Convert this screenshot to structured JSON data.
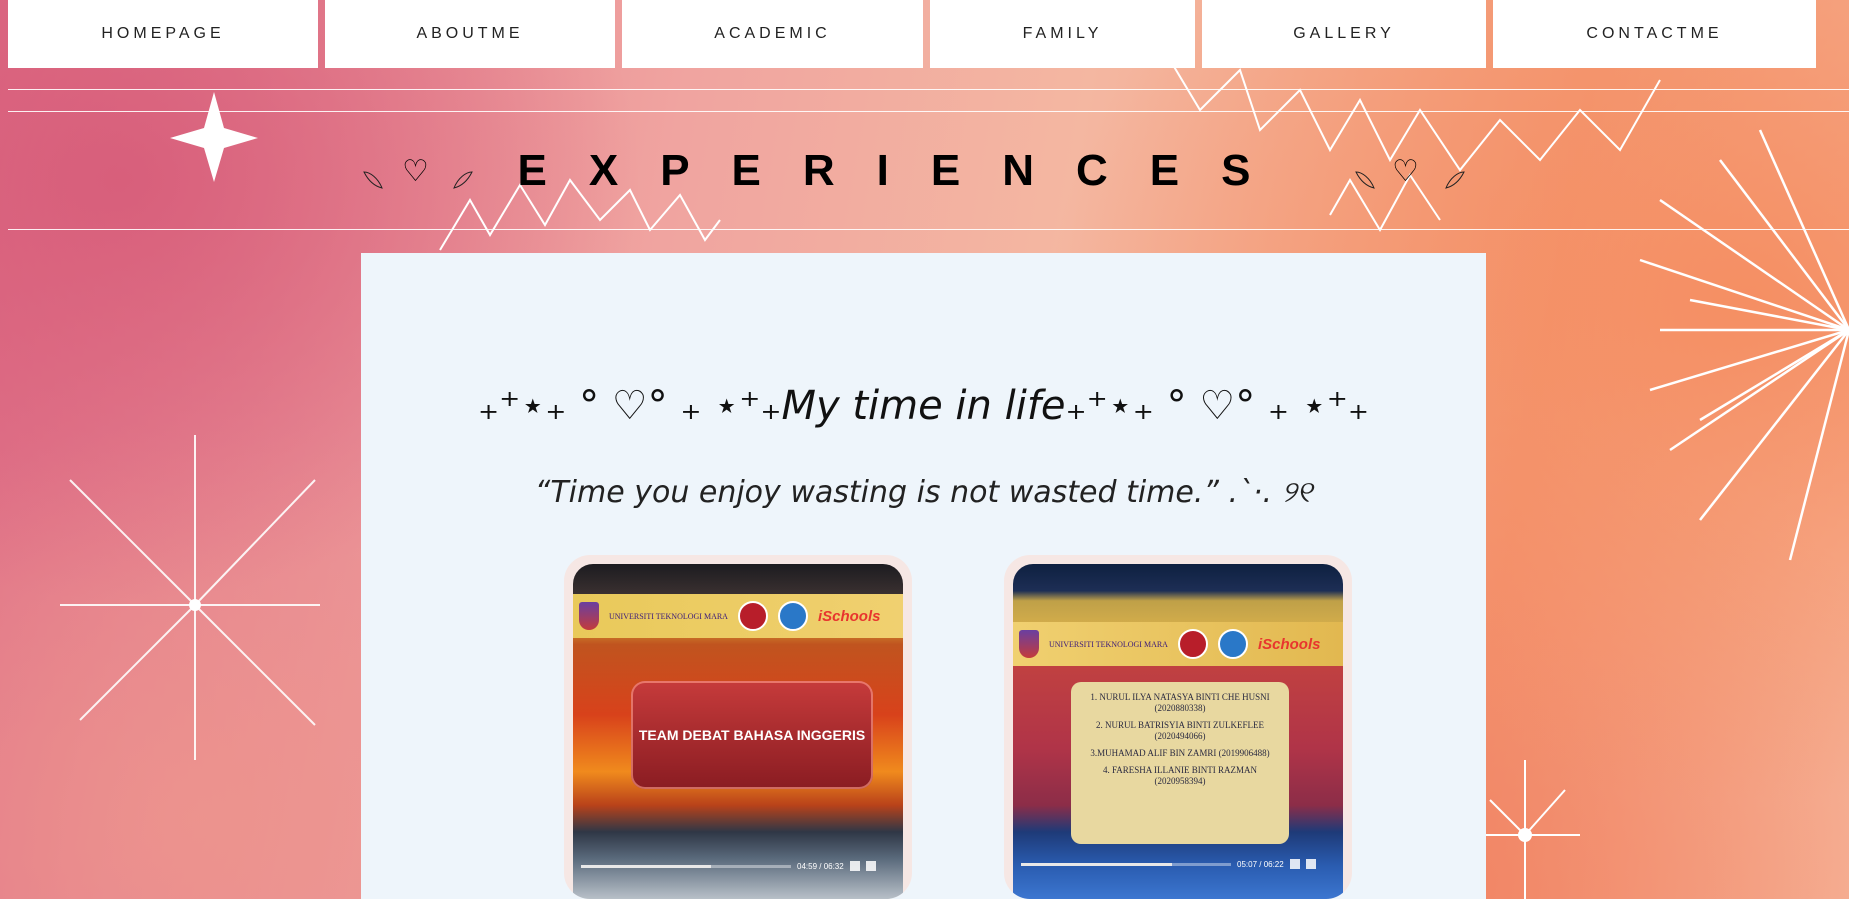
{
  "nav": {
    "items": [
      {
        "label": "HOMEPAGE"
      },
      {
        "label": "ABOUTME"
      },
      {
        "label": "ACADEMIC"
      },
      {
        "label": "FAMILY"
      },
      {
        "label": "GALLERY"
      },
      {
        "label": "CONTACTME"
      }
    ]
  },
  "heading": {
    "title": "EXPERIENCES",
    "heart": "♡",
    "icon": "heart-icon"
  },
  "card": {
    "subtitle": "₊⁺⋆₊ ° ♡° ₊ ⋆⁺₊My time in life₊⁺⋆₊ ° ♡° ₊ ⋆⁺₊",
    "quote": "“Time you enjoy wasting is not wasted time.” .`·. ୨୧",
    "photos": [
      {
        "panel_text": "TEAM DEBAT BAHASA INGGERIS",
        "banner_org": "UNIVERSITI TEKNOLOGI MARA",
        "banner_brand": "iSchools",
        "time": "04:59 / 06:32",
        "progress": 0.62
      },
      {
        "banner_org": "UNIVERSITI TEKNOLOGI MARA",
        "banner_brand": "iSchools",
        "names": [
          "1. NURUL ILYA NATASYA BINTI CHE HUSNI (2020880338)",
          "2. NURUL BATRISYIA BINTI ZULKEFLEE (2020494066)",
          "3.MUHAMAD ALIF BIN ZAMRI (2019906488)",
          "4. FARESHA ILLANIE BINTI RAZMAN (2020958394)"
        ],
        "time": "05:07 / 06:22",
        "progress": 0.72
      }
    ]
  },
  "colors": {
    "nav_bg": "#ffffff",
    "card_bg": "#eef5fb",
    "text": "#000000"
  }
}
